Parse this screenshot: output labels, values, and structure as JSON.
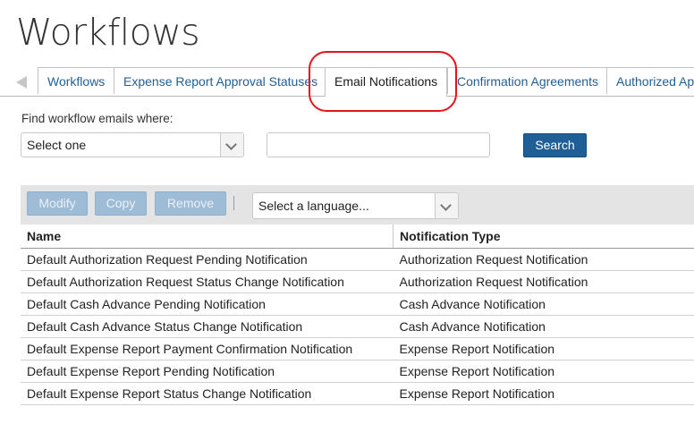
{
  "page": {
    "title": "Workflows"
  },
  "tabs": [
    {
      "label": "Workflows",
      "active": false
    },
    {
      "label": "Expense Report Approval Statuses",
      "active": false
    },
    {
      "label": "Email Notifications",
      "active": true
    },
    {
      "label": "Confirmation Agreements",
      "active": false
    },
    {
      "label": "Authorized Ap",
      "active": false
    }
  ],
  "filter": {
    "label": "Find workflow emails where:",
    "field_select": "Select one",
    "query_value": "",
    "search_label": "Search"
  },
  "toolbar": {
    "modify_label": "Modify",
    "copy_label": "Copy",
    "remove_label": "Remove",
    "language_select": "Select a language..."
  },
  "table": {
    "columns": [
      "Name",
      "Notification Type"
    ],
    "rows": [
      [
        "Default Authorization Request Pending Notification",
        "Authorization Request Notification"
      ],
      [
        "Default Authorization Request Status Change Notification",
        "Authorization Request Notification"
      ],
      [
        "Default Cash Advance Pending Notification",
        "Cash Advance Notification"
      ],
      [
        "Default Cash Advance Status Change Notification",
        "Cash Advance Notification"
      ],
      [
        "Default Expense Report Payment Confirmation Notification",
        "Expense Report Notification"
      ],
      [
        "Default Expense Report Pending Notification",
        "Expense Report Notification"
      ],
      [
        "Default Expense Report Status Change Notification",
        "Expense Report Notification"
      ]
    ]
  },
  "colors": {
    "link_blue": "#1f5f96",
    "highlight_red": "#e3141a",
    "disabled_button": "#9fbcd6"
  }
}
